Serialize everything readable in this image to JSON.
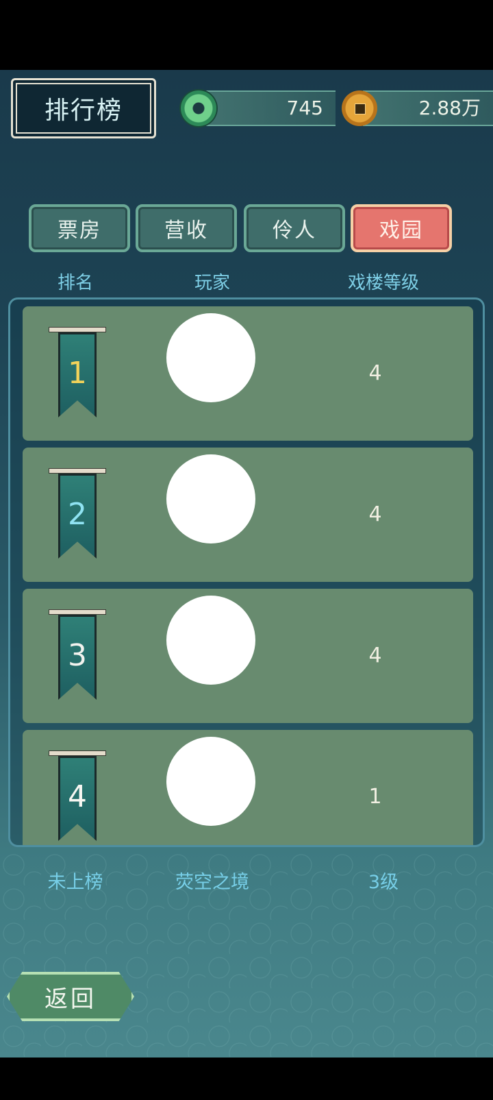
{
  "header": {
    "title": "排行榜"
  },
  "currency": {
    "jade": "745",
    "coins": "2.88万"
  },
  "tabs": [
    {
      "label": "票房",
      "active": false
    },
    {
      "label": "营收",
      "active": false
    },
    {
      "label": "伶人",
      "active": false
    },
    {
      "label": "戏园",
      "active": true
    }
  ],
  "columns": {
    "rank": "排名",
    "player": "玩家",
    "level": "戏楼等级"
  },
  "rows": [
    {
      "rank": "1",
      "level": "4",
      "rank_color": "#f3d35a"
    },
    {
      "rank": "2",
      "level": "4",
      "rank_color": "#8fe3f2"
    },
    {
      "rank": "3",
      "level": "4",
      "rank_color": "#f2f2ee"
    },
    {
      "rank": "4",
      "level": "1",
      "rank_color": "#f7f7f2"
    }
  ],
  "self": {
    "rank": "未上榜",
    "name": "荧空之境",
    "level": "3级"
  },
  "back_label": "返回"
}
